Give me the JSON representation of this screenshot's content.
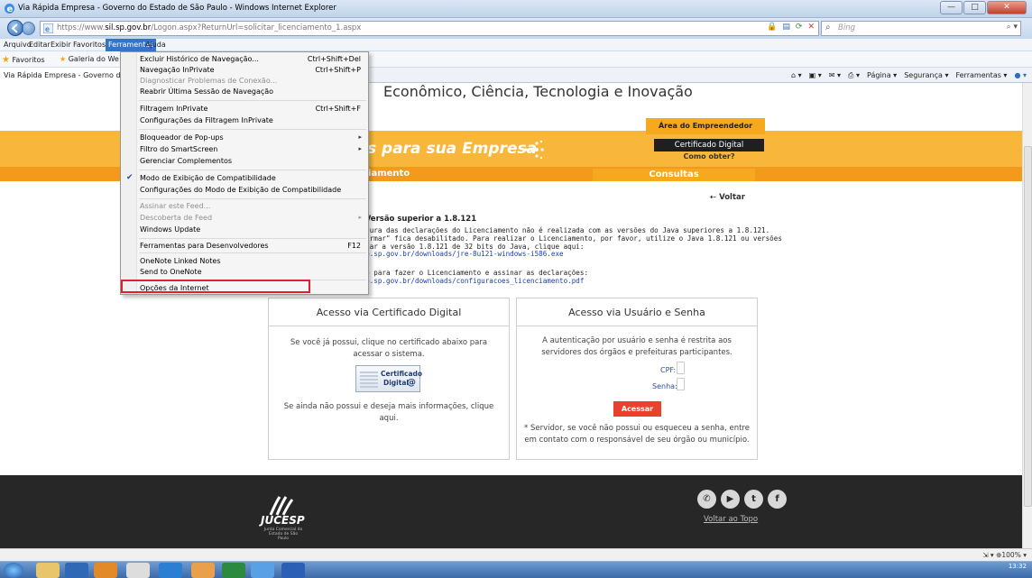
{
  "window": {
    "title": "Via Rápida Empresa - Governo do Estado de São Paulo - Windows Internet Explorer",
    "buttons": {
      "minimize": "—",
      "maximize": "□",
      "close": "✕"
    }
  },
  "address": {
    "url_prefix": "https://www.",
    "url_host": "sil.sp.gov.br",
    "url_path": "/Logon.aspx?ReturnUrl=solicitar_licenciamento_1.aspx",
    "search_placeholder": "Bing"
  },
  "menubar": [
    "Arquivo",
    "Editar",
    "Exibir",
    "Favoritos",
    "Ferramentas",
    "Ajuda"
  ],
  "favorites": {
    "label": "Favoritos",
    "gallery": "Galeria do We"
  },
  "tab": {
    "label": "Via Rápida Empresa - Governo do E"
  },
  "commandbar": [
    "Página ▾",
    "Segurança ▾",
    "Ferramentas ▾"
  ],
  "tools_menu": [
    {
      "label": "Excluir Histórico de Navegação...",
      "shortcut": "Ctrl+Shift+Del"
    },
    {
      "label": "Navegação InPrivate",
      "shortcut": "Ctrl+Shift+P"
    },
    {
      "label": "Diagnosticar Problemas de Conexão...",
      "disabled": true
    },
    {
      "label": "Reabrir Última Sessão de Navegação"
    },
    {
      "label": "Filtragem InPrivate",
      "shortcut": "Ctrl+Shift+F"
    },
    {
      "label": "Configurações da Filtragem InPrivate"
    },
    {
      "label": "Bloqueador de Pop-ups",
      "submenu": true
    },
    {
      "label": "Filtro do SmartScreen",
      "submenu": true
    },
    {
      "label": "Gerenciar Complementos"
    },
    {
      "label": "Modo de Exibição de Compatibilidade",
      "checked": true
    },
    {
      "label": "Configurações do Modo de Exibição de Compatibilidade"
    },
    {
      "label": "Assinar este Feed...",
      "disabled": true
    },
    {
      "label": "Descoberta de Feed",
      "disabled": true,
      "submenu": true
    },
    {
      "label": "Windows Update"
    },
    {
      "label": "Ferramentas para Desenvolvedores",
      "shortcut": "F12"
    },
    {
      "label": "OneNote Linked Notes"
    },
    {
      "label": "Send to OneNote"
    },
    {
      "label": "Opções da Internet",
      "highlighted": true
    }
  ],
  "page": {
    "heading": "Econômico, Ciência, Tecnologia e Inovação",
    "area_empreendedor": "Área do Empreendedor",
    "slogan": "s para sua Empresa",
    "cert_button": "Certificado Digital",
    "cert_sub": "Como obter?",
    "nav_licenciamento": "nciamento",
    "nav_consultas": "Consultas",
    "voltar": "Voltar",
    "notice_title": "a Versão superior a 1.8.121",
    "notice_lines": [
      "satura das declarações do Licenciamento não é realizada com as versões do Java superiores a 1.8.121.",
      "nfirmar\" fica desabilitado. Para realizar o Licenciamento, por favor, utilize o Java 1.8.121 ou versões",
      "aixar a versão 1.8.121 de 32 bits do Java, clique aqui:"
    ],
    "notice_link1": "esp.sp.gov.br/downloads/jre-8u121-windows-i586.exe",
    "notice_line2": "ção para fazer o Licenciamento e assinar as declarações:",
    "notice_link2": "esp.sp.gov.br/downloads/configuracoes_licenciamento.pdf",
    "left_box": {
      "title": "Acesso via Certificado Digital",
      "text": "Se você já possui, clique no certificado abaixo para acessar o sistema.",
      "logo_line1": "Certificado",
      "logo_line2": "Digital",
      "bottom": "Se ainda não possui e deseja mais informações, clique aqui."
    },
    "right_box": {
      "title": "Acesso via Usuário e Senha",
      "text": "A autenticação por usuário e senha é restrita aos servidores dos órgãos e prefeituras participantes.",
      "cpf_label": "CPF:",
      "senha_label": "Senha:",
      "button": "Acessar",
      "note": "* Servidor, se você não possui ou esqueceu a senha, entre em contato com o responsável de seu órgão ou município."
    },
    "footer": {
      "logo_text": "JUCESP",
      "logo_sub": "Junta Comercial do Estado de São Paulo",
      "voltar_topo": "Voltar ao Topo",
      "social": [
        "phone-icon",
        "youtube-icon",
        "twitter-icon",
        "facebook-icon"
      ]
    }
  },
  "statusbar": {
    "zoom": "100%"
  },
  "taskbar": {
    "time": "13:32"
  }
}
